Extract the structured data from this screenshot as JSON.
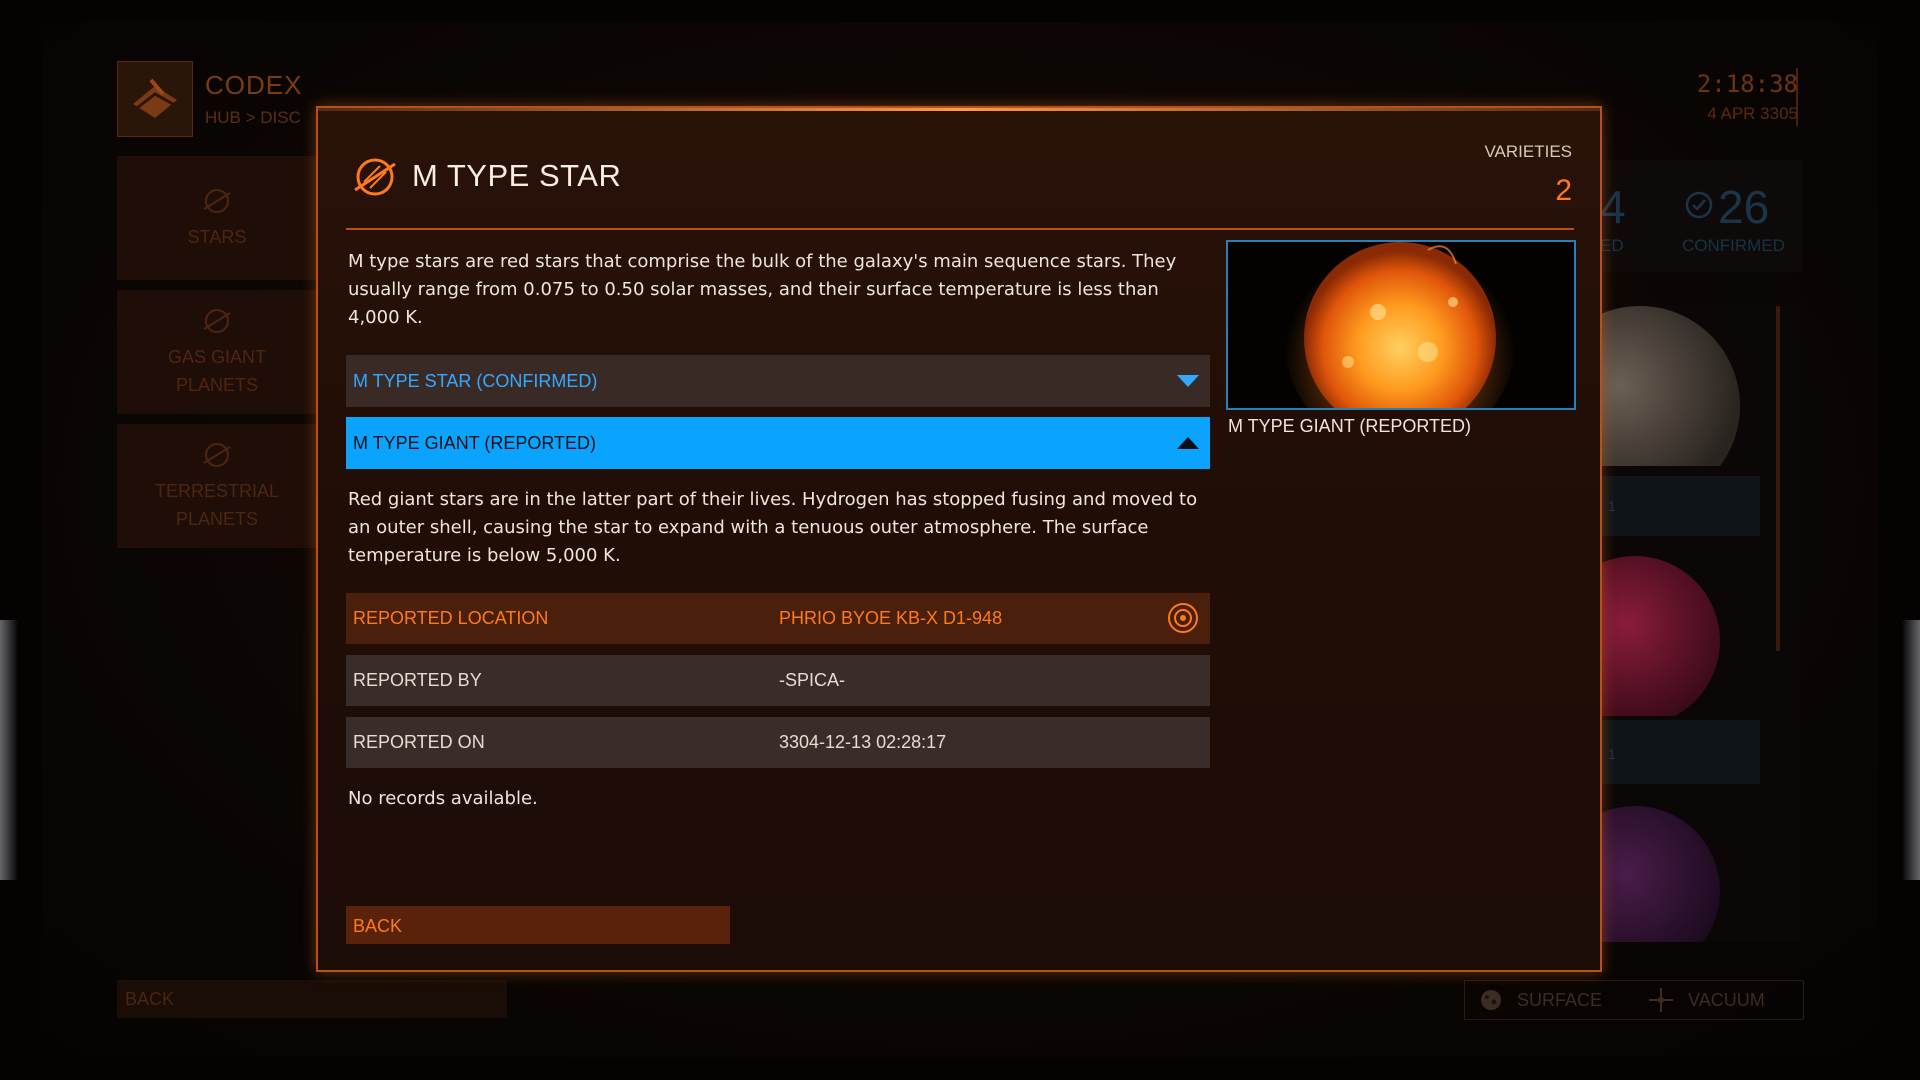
{
  "background": {
    "app_title": "CODEX",
    "breadcrumb": "HUB  >  DISC",
    "clock": "2:18:38",
    "date": "4 APR 3305",
    "nav_items": [
      {
        "label": "STARS",
        "icon": "planet-icon"
      },
      {
        "label": "GAS GIANT PLANETS",
        "icon": "planet-icon"
      },
      {
        "label": "TERRESTRIAL PLANETS",
        "icon": "planet-icon"
      }
    ],
    "stats": {
      "partial_number": "4",
      "partial_label": "ED",
      "confirmed_number": "26",
      "confirmed_label": "CONFIRMED"
    },
    "list_counts": [
      "1",
      "1"
    ],
    "back_label": "BACK",
    "filters": [
      {
        "label": "SURFACE",
        "icon": "surface-icon"
      },
      {
        "label": "VACUUM",
        "icon": "vacuum-icon"
      }
    ]
  },
  "modal": {
    "title": "M TYPE STAR",
    "icon": "planet-icon",
    "varieties_label": "VARIETIES",
    "varieties_count": "2",
    "description": "M type stars are red stars that comprise the bulk of the galaxy's main sequence stars. They usually range from 0.075 to 0.50 solar masses, and their surface temperature is less than 4,000 K.",
    "varieties": [
      {
        "label": "M TYPE STAR (CONFIRMED)",
        "expanded": false
      },
      {
        "label": "M TYPE GIANT (REPORTED)",
        "expanded": true
      }
    ],
    "variety_description": "Red giant stars are in the latter part of their lives. Hydrogen has stopped fusing and moved to an outer shell, causing the star to expand with a tenuous outer atmosphere. The surface temperature is below 5,000 K.",
    "details": {
      "location_key": "REPORTED LOCATION",
      "location_value": "PHRIO BYOE KB-X D1-948",
      "by_key": "REPORTED BY",
      "by_value": "-SPICA-",
      "on_key": "REPORTED ON",
      "on_value": "3304-12-13 02:28:17"
    },
    "no_records": "No records available.",
    "back_label": "BACK",
    "preview_caption": "M TYPE GIANT (REPORTED)"
  },
  "colors": {
    "accent_orange": "#ff7a1a",
    "highlight_blue": "#0aa4ff",
    "confirmed_blue": "#33a8ff",
    "frame_orange": "#b8501a"
  }
}
